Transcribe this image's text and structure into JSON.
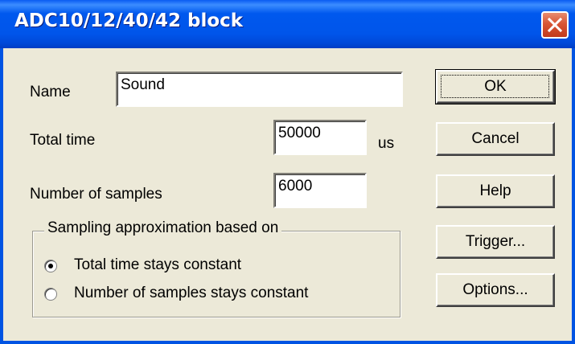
{
  "window": {
    "title": "ADC10/12/40/42 block",
    "close_icon": "close-icon"
  },
  "form": {
    "name_label": "Name",
    "name_value": "Sound",
    "total_time_label": "Total time",
    "total_time_value": "50000",
    "total_time_unit": "us",
    "num_samples_label": "Number of samples",
    "num_samples_value": "6000"
  },
  "sampling": {
    "legend": "Sampling approximation based on",
    "options": [
      {
        "label": "Total time stays constant",
        "selected": true
      },
      {
        "label": "Number of samples stays constant",
        "selected": false
      }
    ]
  },
  "buttons": {
    "ok": "OK",
    "cancel": "Cancel",
    "help": "Help",
    "trigger": "Trigger...",
    "options": "Options..."
  },
  "colors": {
    "titlebar": "#0055ea",
    "dialog_bg": "#ece9d8",
    "close_button": "#d85535"
  }
}
